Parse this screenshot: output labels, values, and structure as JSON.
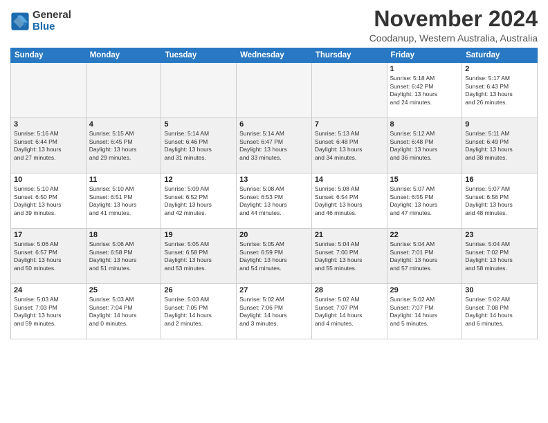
{
  "logo": {
    "general": "General",
    "blue": "Blue"
  },
  "title": "November 2024",
  "location": "Coodanup, Western Australia, Australia",
  "weekdays": [
    "Sunday",
    "Monday",
    "Tuesday",
    "Wednesday",
    "Thursday",
    "Friday",
    "Saturday"
  ],
  "weeks": [
    [
      {
        "day": "",
        "info": ""
      },
      {
        "day": "",
        "info": ""
      },
      {
        "day": "",
        "info": ""
      },
      {
        "day": "",
        "info": ""
      },
      {
        "day": "",
        "info": ""
      },
      {
        "day": "1",
        "info": "Sunrise: 5:18 AM\nSunset: 6:42 PM\nDaylight: 13 hours\nand 24 minutes."
      },
      {
        "day": "2",
        "info": "Sunrise: 5:17 AM\nSunset: 6:43 PM\nDaylight: 13 hours\nand 26 minutes."
      }
    ],
    [
      {
        "day": "3",
        "info": "Sunrise: 5:16 AM\nSunset: 6:44 PM\nDaylight: 13 hours\nand 27 minutes."
      },
      {
        "day": "4",
        "info": "Sunrise: 5:15 AM\nSunset: 6:45 PM\nDaylight: 13 hours\nand 29 minutes."
      },
      {
        "day": "5",
        "info": "Sunrise: 5:14 AM\nSunset: 6:46 PM\nDaylight: 13 hours\nand 31 minutes."
      },
      {
        "day": "6",
        "info": "Sunrise: 5:14 AM\nSunset: 6:47 PM\nDaylight: 13 hours\nand 33 minutes."
      },
      {
        "day": "7",
        "info": "Sunrise: 5:13 AM\nSunset: 6:48 PM\nDaylight: 13 hours\nand 34 minutes."
      },
      {
        "day": "8",
        "info": "Sunrise: 5:12 AM\nSunset: 6:48 PM\nDaylight: 13 hours\nand 36 minutes."
      },
      {
        "day": "9",
        "info": "Sunrise: 5:11 AM\nSunset: 6:49 PM\nDaylight: 13 hours\nand 38 minutes."
      }
    ],
    [
      {
        "day": "10",
        "info": "Sunrise: 5:10 AM\nSunset: 6:50 PM\nDaylight: 13 hours\nand 39 minutes."
      },
      {
        "day": "11",
        "info": "Sunrise: 5:10 AM\nSunset: 6:51 PM\nDaylight: 13 hours\nand 41 minutes."
      },
      {
        "day": "12",
        "info": "Sunrise: 5:09 AM\nSunset: 6:52 PM\nDaylight: 13 hours\nand 42 minutes."
      },
      {
        "day": "13",
        "info": "Sunrise: 5:08 AM\nSunset: 6:53 PM\nDaylight: 13 hours\nand 44 minutes."
      },
      {
        "day": "14",
        "info": "Sunrise: 5:08 AM\nSunset: 6:54 PM\nDaylight: 13 hours\nand 46 minutes."
      },
      {
        "day": "15",
        "info": "Sunrise: 5:07 AM\nSunset: 6:55 PM\nDaylight: 13 hours\nand 47 minutes."
      },
      {
        "day": "16",
        "info": "Sunrise: 5:07 AM\nSunset: 6:56 PM\nDaylight: 13 hours\nand 48 minutes."
      }
    ],
    [
      {
        "day": "17",
        "info": "Sunrise: 5:06 AM\nSunset: 6:57 PM\nDaylight: 13 hours\nand 50 minutes."
      },
      {
        "day": "18",
        "info": "Sunrise: 5:06 AM\nSunset: 6:58 PM\nDaylight: 13 hours\nand 51 minutes."
      },
      {
        "day": "19",
        "info": "Sunrise: 5:05 AM\nSunset: 6:58 PM\nDaylight: 13 hours\nand 53 minutes."
      },
      {
        "day": "20",
        "info": "Sunrise: 5:05 AM\nSunset: 6:59 PM\nDaylight: 13 hours\nand 54 minutes."
      },
      {
        "day": "21",
        "info": "Sunrise: 5:04 AM\nSunset: 7:00 PM\nDaylight: 13 hours\nand 55 minutes."
      },
      {
        "day": "22",
        "info": "Sunrise: 5:04 AM\nSunset: 7:01 PM\nDaylight: 13 hours\nand 57 minutes."
      },
      {
        "day": "23",
        "info": "Sunrise: 5:04 AM\nSunset: 7:02 PM\nDaylight: 13 hours\nand 58 minutes."
      }
    ],
    [
      {
        "day": "24",
        "info": "Sunrise: 5:03 AM\nSunset: 7:03 PM\nDaylight: 13 hours\nand 59 minutes."
      },
      {
        "day": "25",
        "info": "Sunrise: 5:03 AM\nSunset: 7:04 PM\nDaylight: 14 hours\nand 0 minutes."
      },
      {
        "day": "26",
        "info": "Sunrise: 5:03 AM\nSunset: 7:05 PM\nDaylight: 14 hours\nand 2 minutes."
      },
      {
        "day": "27",
        "info": "Sunrise: 5:02 AM\nSunset: 7:06 PM\nDaylight: 14 hours\nand 3 minutes."
      },
      {
        "day": "28",
        "info": "Sunrise: 5:02 AM\nSunset: 7:07 PM\nDaylight: 14 hours\nand 4 minutes."
      },
      {
        "day": "29",
        "info": "Sunrise: 5:02 AM\nSunset: 7:07 PM\nDaylight: 14 hours\nand 5 minutes."
      },
      {
        "day": "30",
        "info": "Sunrise: 5:02 AM\nSunset: 7:08 PM\nDaylight: 14 hours\nand 6 minutes."
      }
    ]
  ]
}
